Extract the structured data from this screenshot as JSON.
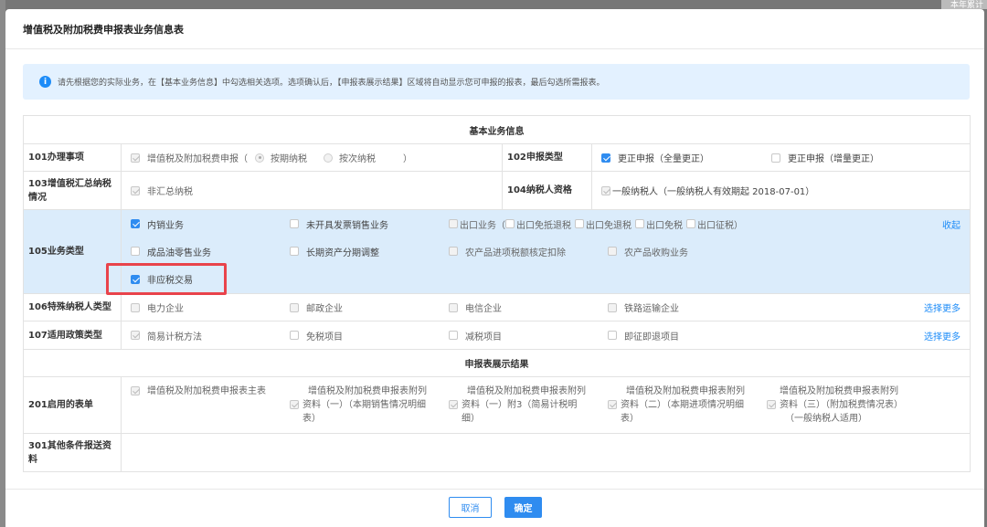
{
  "background": {
    "corner_text": "本年累计"
  },
  "dialog": {
    "title": "增值税及附加税费申报表业务信息表",
    "notice": "请先根据您的实际业务，在【基本业务信息】中勾选相关选项。选项确认后，【申报表展示结果】区域将自动显示您可申报的报表，最后勾选所需报表。"
  },
  "sections": {
    "basic": "基本业务信息",
    "result": "申报表展示结果"
  },
  "rows": {
    "r101": {
      "label": "101办理事项",
      "option": "增值税及附加税费申报（",
      "radio1": "按期纳税",
      "radio2": "按次纳税",
      "close": "）"
    },
    "r102": {
      "label": "102申报类型",
      "opt1": "更正申报（全量更正）",
      "opt2": "更正申报（增量更正）"
    },
    "r103": {
      "label": "103增值税汇总纳税情况",
      "opt1": "非汇总纳税"
    },
    "r104": {
      "label": "104纳税人资格",
      "opt1": "一般纳税人（一般纳税人有效期起 2018-07-01）"
    },
    "r105": {
      "label": "105业务类型",
      "collapse": "收起",
      "items": [
        "内销业务",
        "未开具发票销售业务",
        "成品油零售业务",
        "长期资产分期调整",
        "农产品进项税额核定扣除",
        "农产品收购业务",
        "非应税交易"
      ],
      "export_group": {
        "main": "出口业务（",
        "sub1": "出口免抵退税",
        "sub2": "出口免退税",
        "sub3": "出口免税",
        "sub4": "出口征税）"
      }
    },
    "r106": {
      "label": "106特殊纳税人类型",
      "items": [
        "电力企业",
        "邮政企业",
        "电信企业",
        "铁路运输企业"
      ],
      "more": "选择更多"
    },
    "r107": {
      "label": "107适用政策类型",
      "items": [
        "简易计税方法",
        "免税项目",
        "减税项目",
        "即征即退项目"
      ],
      "more": "选择更多"
    },
    "r201": {
      "label": "201启用的表单",
      "f1": "增值税及附加税费申报表主表",
      "f2_head": "增值税及附加税费申报表附列",
      "f2_l1": "资料（一）（本期销售情况明细",
      "f2_l2": "表）",
      "f3_head": "增值税及附加税费申报表附列",
      "f3_l1": "资料（一）附3（简易计税明",
      "f3_l2": "细）",
      "f4_head": "增值税及附加税费申报表附列",
      "f4_l1": "资料（二）（本期进项情况明细",
      "f4_l2": "表）",
      "f5_head": "增值税及附加税费申报表附列",
      "f5_l1": "资料（三）（附加税费情况表）",
      "f5_l2": "（一般纳税人适用）"
    },
    "r301": {
      "label": "301其他条件报送资料"
    }
  },
  "buttons": {
    "cancel": "取消",
    "ok": "确定"
  }
}
